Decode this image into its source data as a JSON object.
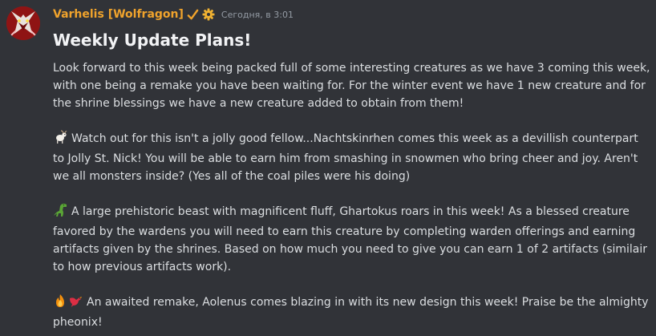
{
  "message": {
    "author": "Varhelis [Wolfragon]",
    "timestamp": "Сегодня, в 3:01",
    "title": "Weekly Update Plans!",
    "paragraphs": [
      "Look forward to this week being packed full of some interesting creatures as we have 3 coming this week, with one being a remake you have been waiting for. For the winter event we have 1 new creature and for the shrine blessings we have a new creature added to obtain from them!",
      "Watch out for this isn't a jolly good fellow...Nachtskinrhen comes this week as a devillish counterpart to Jolly St. Nick! You will be able to earn him from smashing in snowmen who bring cheer and joy. Aren't we all monsters inside? (Yes all of the coal piles were his doing)",
      "A large prehistoric beast with magnificent fluff, Ghartokus roars in this week! As a blessed creature favored by the wardens you will need to earn this creature by completing warden offerings and earning artifacts given by the shrines. Based on how much you need to give you can earn 1 of 2 artifacts (similair to how previous artifacts work).",
      "An awaited remake, Aolenus comes blazing in with its new design this week! Praise be the almighty pheonix!"
    ],
    "icons": {
      "badge": "check-mark-icon",
      "role": "gear-icon",
      "p2": "goat-emoji-icon",
      "p3": "t-rex-emoji-icon",
      "p4": [
        "fire-emoji-icon",
        "red-bird-emoji-icon"
      ]
    },
    "colors": {
      "username": "#f0a32c",
      "background": "#313338",
      "text": "#dbdee1"
    }
  }
}
